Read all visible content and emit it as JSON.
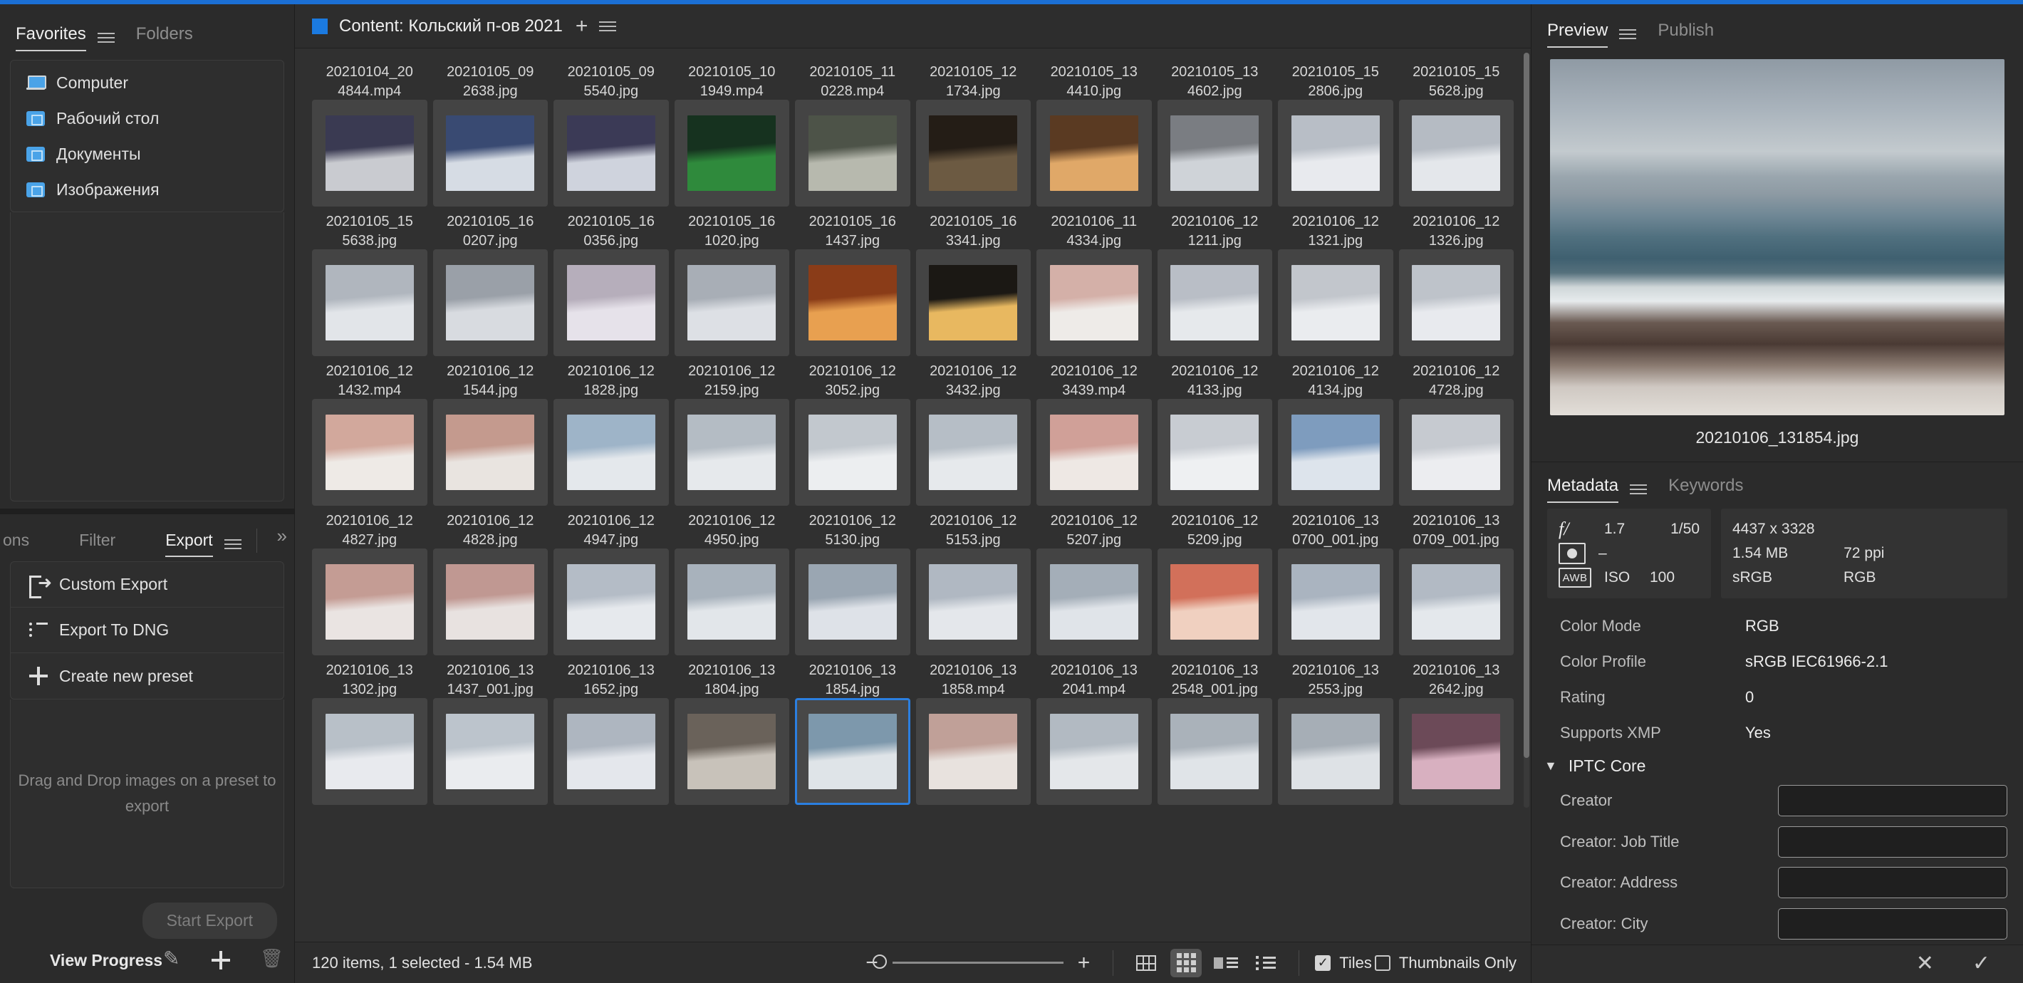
{
  "left_panel": {
    "tabs": [
      {
        "label": "Favorites",
        "active": true
      },
      {
        "label": "Folders",
        "active": false
      }
    ],
    "favorites": [
      {
        "label": "Computer",
        "icon": "computer-icon"
      },
      {
        "label": "Рабочий стол",
        "icon": "folder-icon"
      },
      {
        "label": "Документы",
        "icon": "folder-icon"
      },
      {
        "label": "Изображения",
        "icon": "folder-icon"
      }
    ]
  },
  "export_panel": {
    "tabs": [
      {
        "label": "ons",
        "active": false
      },
      {
        "label": "Filter",
        "active": false
      },
      {
        "label": "Export",
        "active": true
      }
    ],
    "scroll_more": "»",
    "presets": [
      {
        "label": "Custom Export",
        "icon": "export-icon"
      },
      {
        "label": "Export To DNG",
        "icon": "list-icon"
      },
      {
        "label": "Create new preset",
        "icon": "plus-icon"
      }
    ],
    "dropzone_text": "Drag and Drop\nimages on a preset\nto export",
    "start_export_label": "Start Export",
    "view_progress_label": "View Progress",
    "footer_icons": [
      "pencil-icon",
      "plus-icon",
      "trash-icon"
    ]
  },
  "content": {
    "title": "Content: Кольский п-ов 2021",
    "add_label": "+",
    "grid": [
      {
        "name": "20210104_20\n4844.mp4",
        "color1": "#3a3a52",
        "color2": "#c9cbd0",
        "selected": false
      },
      {
        "name": "20210105_09\n2638.jpg",
        "color1": "#394a72",
        "color2": "#d6dce4",
        "selected": false
      },
      {
        "name": "20210105_09\n5540.jpg",
        "color1": "#3b3a56",
        "color2": "#cfd3dd",
        "selected": false
      },
      {
        "name": "20210105_10\n1949.mp4",
        "color1": "#16321f",
        "color2": "#2f8a3c",
        "selected": false
      },
      {
        "name": "20210105_11\n0228.mp4",
        "color1": "#4d5348",
        "color2": "#b7b9ae",
        "selected": false
      },
      {
        "name": "20210105_12\n1734.jpg",
        "color1": "#241d16",
        "color2": "#6c5a42",
        "selected": false
      },
      {
        "name": "20210105_13\n4410.jpg",
        "color1": "#5a3a22",
        "color2": "#e0a868",
        "selected": false
      },
      {
        "name": "20210105_13\n4602.jpg",
        "color1": "#7a7d82",
        "color2": "#cfd3d8",
        "selected": false
      },
      {
        "name": "20210105_15\n2806.jpg",
        "color1": "#b8bec6",
        "color2": "#e8eaee",
        "selected": false
      },
      {
        "name": "20210105_15\n5628.jpg",
        "color1": "#b5bbc3",
        "color2": "#e4e7eb",
        "selected": false
      },
      {
        "name": "20210105_15\n5638.jpg",
        "color1": "#b0b6be",
        "color2": "#e2e5e9",
        "selected": false
      },
      {
        "name": "20210105_16\n0207.jpg",
        "color1": "#9aa0a8",
        "color2": "#d8dbe0",
        "selected": false
      },
      {
        "name": "20210105_16\n0356.jpg",
        "color1": "#b6aebb",
        "color2": "#e6e2ea",
        "selected": false
      },
      {
        "name": "20210105_16\n1020.jpg",
        "color1": "#a8aeb6",
        "color2": "#dde0e5",
        "selected": false
      },
      {
        "name": "20210105_16\n1437.jpg",
        "color1": "#8a3c18",
        "color2": "#e8a050",
        "selected": false
      },
      {
        "name": "20210105_16\n3341.jpg",
        "color1": "#1b1814",
        "color2": "#e8b860",
        "selected": false
      },
      {
        "name": "20210106_11\n4334.jpg",
        "color1": "#d4b0a8",
        "color2": "#eeebe8",
        "selected": false
      },
      {
        "name": "20210106_12\n1211.jpg",
        "color1": "#b9bec6",
        "color2": "#e6e9ec",
        "selected": false
      },
      {
        "name": "20210106_12\n1321.jpg",
        "color1": "#c2c6cc",
        "color2": "#eaecef",
        "selected": false
      },
      {
        "name": "20210106_12\n1326.jpg",
        "color1": "#bec3ca",
        "color2": "#e8eaee",
        "selected": false
      },
      {
        "name": "20210106_12\n1432.mp4",
        "color1": "#d2a89c",
        "color2": "#eeeae6",
        "selected": false
      },
      {
        "name": "20210106_12\n1544.jpg",
        "color1": "#c49a8e",
        "color2": "#e9e4e0",
        "selected": false
      },
      {
        "name": "20210106_12\n1828.jpg",
        "color1": "#9eb4c8",
        "color2": "#e4e8ec",
        "selected": false
      },
      {
        "name": "20210106_12\n2159.jpg",
        "color1": "#b4bcc4",
        "color2": "#e6e9ec",
        "selected": false
      },
      {
        "name": "20210106_12\n3052.jpg",
        "color1": "#c2c8ce",
        "color2": "#eceef0",
        "selected": false
      },
      {
        "name": "20210106_12\n3432.jpg",
        "color1": "#b6bec6",
        "color2": "#e6e9ec",
        "selected": false
      },
      {
        "name": "20210106_12\n3439.mp4",
        "color1": "#d0a098",
        "color2": "#eee8e4",
        "selected": false
      },
      {
        "name": "20210106_12\n4133.jpg",
        "color1": "#c8ccd2",
        "color2": "#eef0f2",
        "selected": false
      },
      {
        "name": "20210106_12\n4134.jpg",
        "color1": "#7e9cbe",
        "color2": "#dde4ec",
        "selected": false
      },
      {
        "name": "20210106_12\n4728.jpg",
        "color1": "#c6cad0",
        "color2": "#ecedf0",
        "selected": false
      },
      {
        "name": "20210106_12\n4827.jpg",
        "color1": "#c49c94",
        "color2": "#eae4e2",
        "selected": false
      },
      {
        "name": "20210106_12\n4828.jpg",
        "color1": "#c09892",
        "color2": "#e8e2e0",
        "selected": false
      },
      {
        "name": "20210106_12\n4947.jpg",
        "color1": "#b4bcc6",
        "color2": "#e6e9ed",
        "selected": false
      },
      {
        "name": "20210106_12\n4950.jpg",
        "color1": "#a8b2bc",
        "color2": "#e2e6ea",
        "selected": false
      },
      {
        "name": "20210106_12\n5130.jpg",
        "color1": "#9aa6b2",
        "color2": "#dee2e8",
        "selected": false
      },
      {
        "name": "20210106_12\n5153.jpg",
        "color1": "#b0b8c2",
        "color2": "#e4e7eb",
        "selected": false
      },
      {
        "name": "20210106_12\n5207.jpg",
        "color1": "#a4aeb8",
        "color2": "#e0e4e9",
        "selected": false
      },
      {
        "name": "20210106_12\n5209.jpg",
        "color1": "#d2705a",
        "color2": "#f0d0c0",
        "selected": false
      },
      {
        "name": "20210106_13\n0700_001.jpg",
        "color1": "#aab4c0",
        "color2": "#e2e6eb",
        "selected": false
      },
      {
        "name": "20210106_13\n0709_001.jpg",
        "color1": "#b2bac4",
        "color2": "#e4e8ec",
        "selected": false
      },
      {
        "name": "20210106_13\n1302.jpg",
        "color1": "#b8c0c8",
        "color2": "#e8eaee",
        "selected": false
      },
      {
        "name": "20210106_13\n1437_001.jpg",
        "color1": "#bcc4cc",
        "color2": "#eaecef",
        "selected": false
      },
      {
        "name": "20210106_13\n1652.jpg",
        "color1": "#aeb6c0",
        "color2": "#e4e7ec",
        "selected": false
      },
      {
        "name": "20210106_13\n1804.jpg",
        "color1": "#6a625a",
        "color2": "#c8c2ba",
        "selected": false
      },
      {
        "name": "20210106_13\n1854.jpg",
        "color1": "#7d98ac",
        "color2": "#dfe4e8",
        "selected": true
      },
      {
        "name": "20210106_13\n1858.mp4",
        "color1": "#c0a098",
        "color2": "#e8e2de",
        "selected": false
      },
      {
        "name": "20210106_13\n2041.mp4",
        "color1": "#b2bac2",
        "color2": "#e4e7ea",
        "selected": false
      },
      {
        "name": "20210106_13\n2548_001.jpg",
        "color1": "#aab2ba",
        "color2": "#e0e4e8",
        "selected": false
      },
      {
        "name": "20210106_13\n2553.jpg",
        "color1": "#a6aeb6",
        "color2": "#dee2e6",
        "selected": false
      },
      {
        "name": "20210106_13\n2642.jpg",
        "color1": "#6c4a58",
        "color2": "#d8b0c0",
        "selected": false
      }
    ]
  },
  "bottom_bar": {
    "item_count": "120 items, 1 selected - 1.54 MB",
    "zoom_minus": "−",
    "zoom_plus": "+",
    "view_modes": [
      "grid-outline-icon",
      "grid-filled-icon",
      "detail-view-icon",
      "list-view-icon"
    ],
    "tiles_label": "Tiles",
    "tiles_checked": true,
    "thumbnails_only_label": "Thumbnails Only",
    "thumbnails_only_checked": false
  },
  "right_panel": {
    "tabs": [
      {
        "label": "Preview",
        "active": true
      },
      {
        "label": "Publish",
        "active": false
      }
    ],
    "preview_filename": "20210106_131854.jpg",
    "metadata_tabs": [
      {
        "label": "Metadata",
        "active": true
      },
      {
        "label": "Keywords",
        "active": false
      }
    ],
    "exif": {
      "aperture_icon": "f/",
      "aperture": "1.7",
      "shutter": "1/50",
      "metering_icon": "metering-icon",
      "metering": "–",
      "wb_icon": "AWB",
      "iso_label": "ISO",
      "iso": "100",
      "dimensions": "4437 x 3328",
      "filesize": "1.54 MB",
      "resolution": "72 ppi",
      "colorspace": "sRGB",
      "channels": "RGB"
    },
    "metadata_rows": [
      {
        "label": "Color Mode",
        "value": "RGB"
      },
      {
        "label": "Color Profile",
        "value": "sRGB IEC61966-2.1"
      },
      {
        "label": "Rating",
        "value": "0"
      },
      {
        "label": "Supports XMP",
        "value": "Yes"
      }
    ],
    "iptc_section": "IPTC Core",
    "iptc_fields": [
      {
        "label": "Creator",
        "value": ""
      },
      {
        "label": "Creator: Job Title",
        "value": ""
      },
      {
        "label": "Creator: Address",
        "value": ""
      },
      {
        "label": "Creator: City",
        "value": ""
      }
    ],
    "footer_icons": [
      "close-icon",
      "check-icon"
    ]
  },
  "accent_color": "#1b7ae0"
}
